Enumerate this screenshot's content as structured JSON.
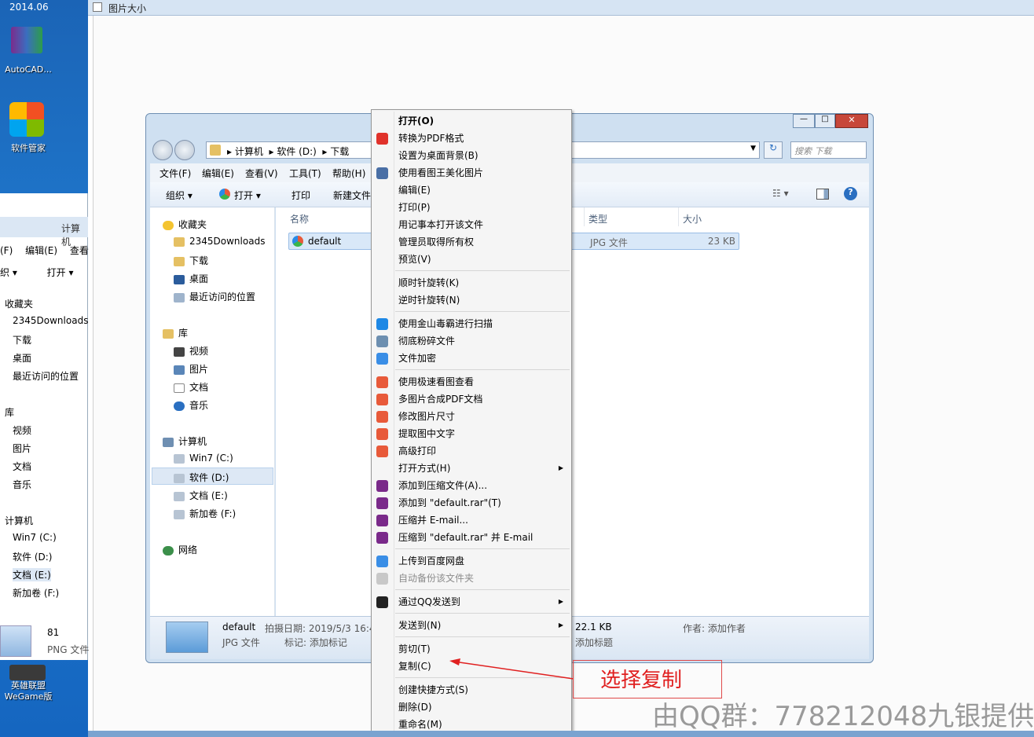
{
  "desktop": {
    "clock": "2014.06",
    "icons": [
      "AutoCAD...",
      "软件管家",
      "英雄联盟\nWeGame版"
    ]
  },
  "paint": {
    "title": "图片大小"
  },
  "bg_explorer": {
    "addr": "计算机",
    "menu": [
      "(F)",
      "编辑(E)",
      "查看"
    ],
    "toolbar": [
      "织 ▾",
      "打开 ▾"
    ],
    "nav": [
      "收藏夹",
      "2345Downloads",
      "下载",
      "桌面",
      "最近访问的位置",
      "库",
      "视频",
      "图片",
      "文档",
      "音乐",
      "计算机",
      "Win7 (C:)",
      "软件 (D:)",
      "文档 (E:)",
      "新加卷 (F:)"
    ],
    "preview_name": "81",
    "preview_type": "PNG 文件"
  },
  "explorer": {
    "breadcrumb": [
      "计算机",
      "软件 (D:)",
      "下载"
    ],
    "search_placeholder": "搜索 下载",
    "menu": [
      "文件(F)",
      "编辑(E)",
      "查看(V)",
      "工具(T)",
      "帮助(H)"
    ],
    "toolbar": {
      "organize": "组织 ▾",
      "open": "打开 ▾",
      "print": "打印",
      "new_folder": "新建文件"
    },
    "nav": {
      "favorites": "收藏夹",
      "fav_items": [
        "2345Downloads",
        "下载",
        "桌面",
        "最近访问的位置"
      ],
      "library": "库",
      "lib_items": [
        "视频",
        "图片",
        "文档",
        "音乐"
      ],
      "computer": "计算机",
      "comp_items": [
        "Win7 (C:)",
        "软件 (D:)",
        "文档 (E:)",
        "新加卷 (F:)"
      ],
      "network": "网络"
    },
    "columns": {
      "name": "名称",
      "type": "类型",
      "size": "大小"
    },
    "file": {
      "name": "default",
      "type": "JPG 文件",
      "size": "23 KB"
    },
    "details": {
      "name": "default",
      "type": "JPG 文件",
      "date_label": "拍摄日期: 2019/5/3 16:4",
      "tag_label": "标记: 添加标记",
      "size": "22.1 KB",
      "title": "添加标题",
      "author": "作者: 添加作者"
    }
  },
  "context_menu": [
    {
      "label": "打开(O)",
      "bold": true,
      "icon": ""
    },
    {
      "label": "转换为PDF格式",
      "icon": "pdf-icon",
      "color": "#e0322b"
    },
    {
      "label": "设置为桌面背景(B)",
      "icon": ""
    },
    {
      "label": "使用看图王美化图片",
      "icon": "photo-editor-icon",
      "color": "#4a6fa5"
    },
    {
      "label": "编辑(E)",
      "icon": ""
    },
    {
      "label": "打印(P)",
      "icon": ""
    },
    {
      "label": "用记事本打开该文件",
      "icon": ""
    },
    {
      "label": "管理员取得所有权",
      "icon": ""
    },
    {
      "label": "预览(V)",
      "icon": ""
    },
    {
      "sep": true
    },
    {
      "label": "顺时针旋转(K)",
      "icon": ""
    },
    {
      "label": "逆时针旋转(N)",
      "icon": ""
    },
    {
      "sep": true
    },
    {
      "label": "使用金山毒霸进行扫描",
      "icon": "antivirus-icon",
      "color": "#1e88e5"
    },
    {
      "label": "彻底粉碎文件",
      "icon": "shredder-icon",
      "color": "#6d8fb0"
    },
    {
      "label": "文件加密",
      "icon": "shield-icon",
      "color": "#3a8ee6"
    },
    {
      "sep": true
    },
    {
      "label": "使用极速看图查看",
      "icon": "fast-viewer-icon",
      "color": "#e85a3a"
    },
    {
      "label": "多图片合成PDF文档",
      "icon": "fast-viewer-icon",
      "color": "#e85a3a"
    },
    {
      "label": "修改图片尺寸",
      "icon": "fast-viewer-icon",
      "color": "#e85a3a"
    },
    {
      "label": "提取图中文字",
      "icon": "fast-viewer-icon",
      "color": "#e85a3a"
    },
    {
      "label": "高级打印",
      "icon": "fast-viewer-icon",
      "color": "#e85a3a"
    },
    {
      "label": "打开方式(H)",
      "icon": "",
      "submenu": true
    },
    {
      "label": "添加到压缩文件(A)...",
      "icon": "winrar-icon",
      "color": "#7a2a8a"
    },
    {
      "label": "添加到 \"default.rar\"(T)",
      "icon": "winrar-icon",
      "color": "#7a2a8a"
    },
    {
      "label": "压缩并 E-mail...",
      "icon": "winrar-icon",
      "color": "#7a2a8a"
    },
    {
      "label": "压缩到 \"default.rar\" 并 E-mail",
      "icon": "winrar-icon",
      "color": "#7a2a8a"
    },
    {
      "sep": true
    },
    {
      "label": "上传到百度网盘",
      "icon": "baidu-cloud-icon",
      "color": "#3a8ee6"
    },
    {
      "label": "自动备份该文件夹",
      "icon": "baidu-cloud-icon",
      "color": "#c8c8c8",
      "disabled": true
    },
    {
      "sep": true
    },
    {
      "label": "通过QQ发送到",
      "icon": "qq-icon",
      "color": "#222",
      "submenu": true
    },
    {
      "sep": true
    },
    {
      "label": "发送到(N)",
      "icon": "",
      "submenu": true
    },
    {
      "sep": true
    },
    {
      "label": "剪切(T)",
      "icon": ""
    },
    {
      "label": "复制(C)",
      "icon": ""
    },
    {
      "sep": true
    },
    {
      "label": "创建快捷方式(S)",
      "icon": ""
    },
    {
      "label": "删除(D)",
      "icon": ""
    },
    {
      "label": "重命名(M)",
      "icon": ""
    }
  ],
  "annotation": {
    "label": "选择复制",
    "color": "#e02020"
  },
  "watermark": "由QQ群：778212048九银提供"
}
